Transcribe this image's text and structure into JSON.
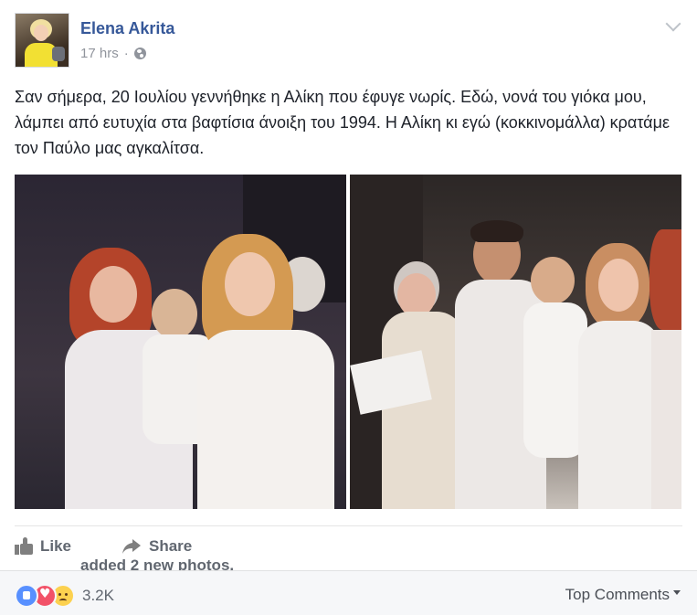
{
  "post": {
    "author": "Elena Akrita",
    "action_text": "added 2 new photos.",
    "timestamp": "17 hrs",
    "separator": "·",
    "privacy_icon": "globe-icon",
    "text": "Σαν σήμερα, 20 Ιουλίου γεννήθηκε η Αλίκη που έφυγε νωρίς. Εδώ, νονά του γιόκα μου, λάμπει από ευτυχία στα βαφτίσια άνοιξη του 1994. Η Αλίκη κι εγώ (κοκκινομάλλα) κρατάμε τον Παύλο μας αγκαλίτσα.",
    "photos": [
      {
        "name": "baptism-photo-1",
        "description_icon": "photo"
      },
      {
        "name": "baptism-photo-2",
        "description_icon": "photo"
      }
    ]
  },
  "actions": {
    "like_label": "Like",
    "share_label": "Share"
  },
  "reactions": {
    "types": [
      "like",
      "love",
      "sad"
    ],
    "count": "3.2K"
  },
  "comments": {
    "sort_label": "Top Comments"
  },
  "colors": {
    "link": "#365899",
    "meta": "#90949c",
    "like_reaction": "#5890ff",
    "love_reaction": "#f25268",
    "sad_reaction": "#fcd14f"
  }
}
